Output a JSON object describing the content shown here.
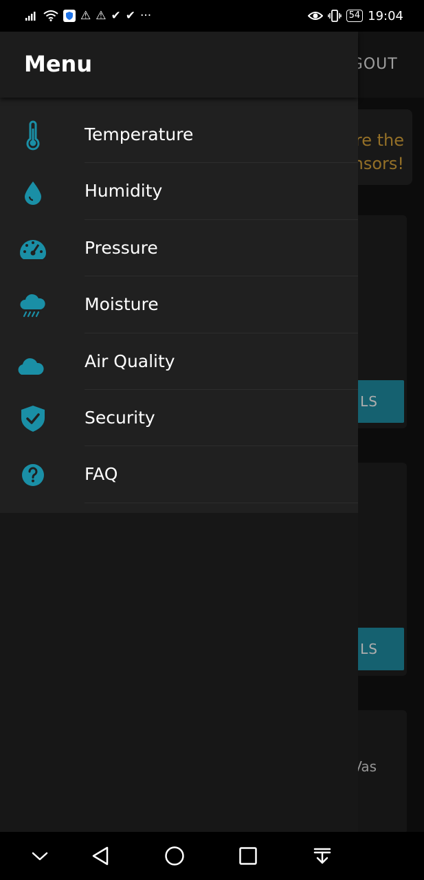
{
  "status_bar": {
    "time": "19:04",
    "battery": "54",
    "left_glyphs": [
      "⚠",
      "⚠",
      "✔",
      "✔",
      "···"
    ]
  },
  "background_app": {
    "logout_label": "LOGOUT",
    "promo_line_1": "re the",
    "promo_line_2": "nsors!",
    "details_button_label": "LS",
    "card_3_text": "Vas",
    "accent_color": "#1f8fa6",
    "promo_color": "#d9a43a"
  },
  "drawer": {
    "title": "Menu",
    "icon_color": "#1a8fa6",
    "items": [
      {
        "label": "Temperature",
        "icon": "thermometer-icon"
      },
      {
        "label": "Humidity",
        "icon": "water-drop-icon"
      },
      {
        "label": "Pressure",
        "icon": "speedometer-icon"
      },
      {
        "label": "Moisture",
        "icon": "rain-cloud-icon"
      },
      {
        "label": "Air Quality",
        "icon": "cloud-moon-icon"
      },
      {
        "label": "Security",
        "icon": "shield-check-icon"
      },
      {
        "label": "FAQ",
        "icon": "question-circle-icon"
      }
    ]
  },
  "nav_bar": {
    "buttons": [
      "collapse-icon",
      "back-icon",
      "home-icon",
      "recents-icon",
      "notification-pull-icon"
    ]
  }
}
